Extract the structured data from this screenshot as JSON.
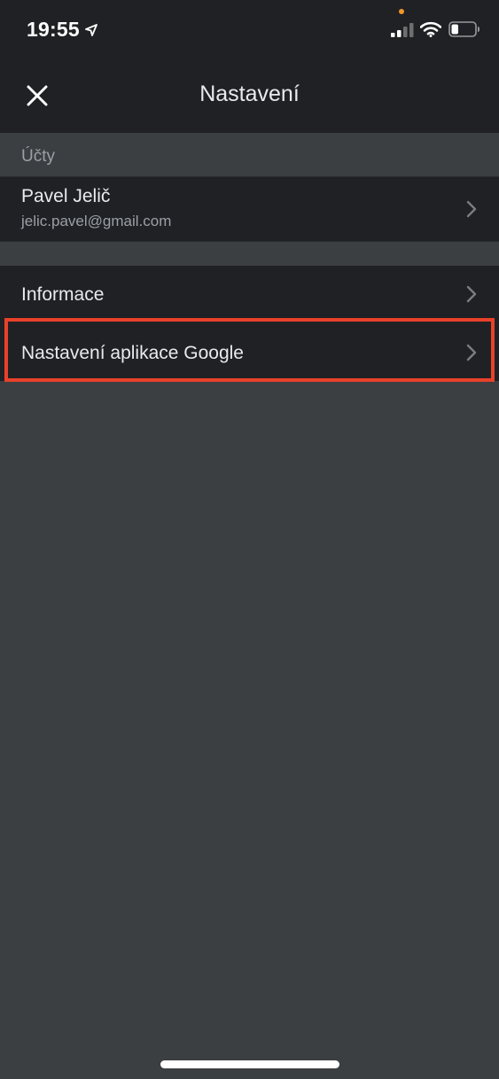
{
  "status_bar": {
    "time": "19:55",
    "location_icon": "location-arrow-icon",
    "signal_icon": "cellular-signal-icon",
    "wifi_icon": "wifi-icon",
    "battery_icon": "battery-icon",
    "battery_level": 0.3,
    "privacy_dot_color": "#f0962a"
  },
  "header": {
    "title": "Nastavení",
    "close_icon": "close-icon"
  },
  "accounts_section": {
    "label": "Účty",
    "account": {
      "name": "Pavel Jelič",
      "email": "jelic.pavel@gmail.com"
    }
  },
  "menu": {
    "items": [
      {
        "label": "Informace"
      },
      {
        "label": "Nastavení aplikace Google"
      }
    ]
  },
  "highlight": {
    "color": "#e8412a",
    "target": "Nastavení aplikace Google"
  },
  "colors": {
    "background": "#3c3f42",
    "surface": "#202124",
    "text_primary": "#e8eaed",
    "text_secondary": "#9aa0a6"
  }
}
